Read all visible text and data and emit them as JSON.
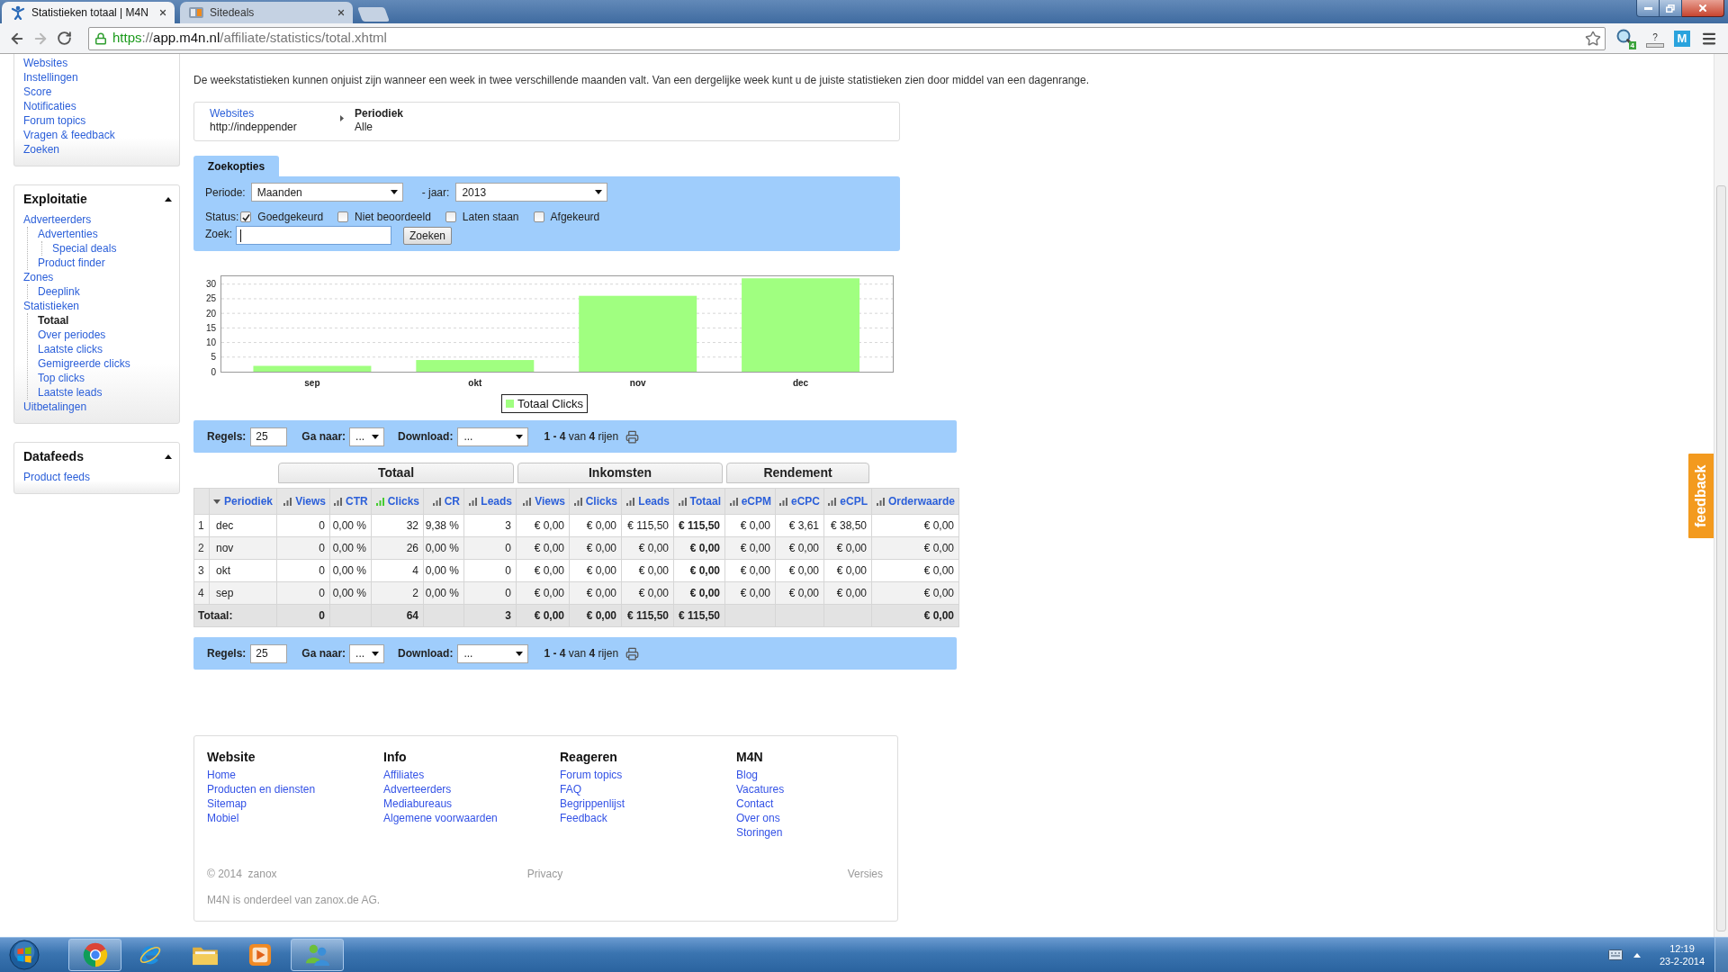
{
  "browser": {
    "tabs": [
      {
        "title": "Statistieken totaal | M4N",
        "selected": true,
        "kind": "figure"
      },
      {
        "title": "Sitedeals",
        "selected": false,
        "kind": "tile"
      }
    ],
    "nav_buttons": [
      {
        "kind": "back",
        "disabled": false
      },
      {
        "kind": "forward",
        "disabled": true
      },
      {
        "kind": "reload",
        "disabled": false
      }
    ],
    "address": [
      {
        "text": "https",
        "kind": "secure"
      },
      {
        "text": "://",
        "kind": "dim"
      },
      {
        "text": "app.m4n.nl",
        "kind": "host"
      },
      {
        "text": "/affiliate/statistics/total.xhtml",
        "kind": "dim"
      }
    ],
    "extensions": [
      {
        "kind": "magnifier",
        "badge": "4"
      },
      {
        "kind": "help",
        "label": "?"
      },
      {
        "kind": "logo",
        "label": "M"
      }
    ]
  },
  "sidebar": {
    "account_links": [
      "Websites",
      "Instellingen",
      "Score",
      "Notificaties",
      "Forum topics",
      "Vragen & feedback",
      "Zoeken"
    ],
    "panels": [
      {
        "title": "Exploitatie",
        "expanded": true,
        "items": [
          {
            "label": "Adverteerders",
            "selected": false,
            "children": [
              {
                "label": "Advertenties",
                "selected": false,
                "children": [
                  {
                    "label": "Special deals",
                    "selected": false
                  }
                ]
              },
              {
                "label": "Product finder",
                "selected": false
              }
            ]
          },
          {
            "label": "Zones",
            "selected": false,
            "children": [
              {
                "label": "Deeplink",
                "selected": false
              }
            ]
          },
          {
            "label": "Statistieken",
            "selected": false,
            "children": [
              {
                "label": "Totaal",
                "selected": true
              },
              {
                "label": "Over periodes",
                "selected": false
              },
              {
                "label": "Laatste clicks",
                "selected": false
              },
              {
                "label": "Gemigreerde clicks",
                "selected": false
              },
              {
                "label": "Top clicks",
                "selected": false
              },
              {
                "label": "Laatste leads",
                "selected": false
              }
            ]
          },
          {
            "label": "Uitbetalingen",
            "selected": false
          }
        ]
      },
      {
        "title": "Datafeeds",
        "expanded": true,
        "items": [
          {
            "label": "Product feeds",
            "selected": false
          }
        ]
      }
    ]
  },
  "notice": "De weekstatistieken kunnen onjuist zijn wanneer een week in twee verschillende maanden valt. Van een dergelijke week kunt u de juiste statistieken zien door middel van een dagenrange.",
  "breadcrumb": [
    {
      "label": "Websites",
      "value": "http://indeppender",
      "link": true
    },
    {
      "label": "Periodiek",
      "value": "Alle",
      "link": false
    }
  ],
  "search": {
    "tab": "Zoekopties",
    "period_label": "Periode:",
    "period": "Maanden",
    "year_label": "- jaar:",
    "year": "2013",
    "status_label": "Status:",
    "statuses": [
      {
        "label": "Goedgekeurd",
        "checked": true
      },
      {
        "label": "Niet beoordeeld",
        "checked": false
      },
      {
        "label": "Laten staan",
        "checked": false
      },
      {
        "label": "Afgekeurd",
        "checked": false
      }
    ],
    "query_label": "Zoek:",
    "query_focused": true,
    "button": "Zoeken"
  },
  "chart": {
    "chart_data": {
      "type": "bar",
      "categories": [
        "sep",
        "okt",
        "nov",
        "dec"
      ],
      "series": [
        {
          "name": "Totaal Clicks",
          "color": "#a0ff80",
          "values": [
            2,
            4,
            26,
            32
          ]
        }
      ],
      "ylim": [
        0,
        33
      ],
      "yticks": [
        0,
        5,
        10,
        15,
        20,
        25,
        30
      ],
      "grid": true
    }
  },
  "toolbars": [
    {
      "rows_label": "Regels:",
      "rows": "25",
      "goto_label": "Ga naar:",
      "goto": "...",
      "download_label": "Download:",
      "download": "...",
      "range": "**1 - 4** van **4** rijen"
    },
    {
      "rows_label": "Regels:",
      "rows": "25",
      "goto_label": "Ga naar:",
      "goto": "...",
      "download_label": "Download:",
      "download": "...",
      "range": "**1 - 4** van **4** rijen"
    }
  ],
  "table": {
    "header_groups": [
      {
        "columns": [
          {
            "label": "Periodiek",
            "kind": "period",
            "sorted": true,
            "charted": false,
            "emphasis": false
          }
        ]
      },
      {
        "label": "Totaal",
        "columns": [
          {
            "label": "Views",
            "kind": "metric",
            "sorted": false,
            "charted": false,
            "emphasis": false
          },
          {
            "label": "CTR",
            "kind": "metric",
            "sorted": false,
            "charted": false,
            "emphasis": false
          },
          {
            "label": "Clicks",
            "kind": "metric",
            "sorted": false,
            "charted": true,
            "emphasis": false
          },
          {
            "label": "CR",
            "kind": "metric",
            "sorted": false,
            "charted": false,
            "emphasis": false
          },
          {
            "label": "Leads",
            "kind": "metric",
            "sorted": false,
            "charted": false,
            "emphasis": false
          }
        ]
      },
      {
        "label": "Inkomsten",
        "columns": [
          {
            "label": "Views",
            "kind": "metric",
            "sorted": false,
            "charted": false,
            "emphasis": false
          },
          {
            "label": "Clicks",
            "kind": "metric",
            "sorted": false,
            "charted": false,
            "emphasis": false
          },
          {
            "label": "Leads",
            "kind": "metric",
            "sorted": false,
            "charted": false,
            "emphasis": false
          },
          {
            "label": "Totaal",
            "kind": "metric",
            "sorted": false,
            "charted": false,
            "emphasis": true
          }
        ]
      },
      {
        "label": "Rendement",
        "columns": [
          {
            "label": "eCPM",
            "kind": "metric",
            "sorted": false,
            "charted": false,
            "emphasis": false
          },
          {
            "label": "eCPC",
            "kind": "metric",
            "sorted": false,
            "charted": false,
            "emphasis": false
          },
          {
            "label": "eCPL",
            "kind": "metric",
            "sorted": false,
            "charted": false,
            "emphasis": false
          }
        ]
      },
      {
        "columns": [
          {
            "label": "Orderwaarde",
            "kind": "metric",
            "sorted": false,
            "charted": false,
            "emphasis": false
          }
        ]
      }
    ],
    "rows": [
      {
        "index": "1",
        "cells": [
          "dec",
          "0",
          "0,00 %",
          "32",
          "9,38 %",
          "3",
          "€ 0,00",
          "€ 0,00",
          "€ 115,50",
          "€ 115,50",
          "€ 0,00",
          "€ 3,61",
          "€ 38,50",
          "€ 0,00"
        ]
      },
      {
        "index": "2",
        "cells": [
          "nov",
          "0",
          "0,00 %",
          "26",
          "0,00 %",
          "0",
          "€ 0,00",
          "€ 0,00",
          "€ 0,00",
          "€ 0,00",
          "€ 0,00",
          "€ 0,00",
          "€ 0,00",
          "€ 0,00"
        ]
      },
      {
        "index": "3",
        "cells": [
          "okt",
          "0",
          "0,00 %",
          "4",
          "0,00 %",
          "0",
          "€ 0,00",
          "€ 0,00",
          "€ 0,00",
          "€ 0,00",
          "€ 0,00",
          "€ 0,00",
          "€ 0,00",
          "€ 0,00"
        ]
      },
      {
        "index": "4",
        "cells": [
          "sep",
          "0",
          "0,00 %",
          "2",
          "0,00 %",
          "0",
          "€ 0,00",
          "€ 0,00",
          "€ 0,00",
          "€ 0,00",
          "€ 0,00",
          "€ 0,00",
          "€ 0,00",
          "€ 0,00"
        ]
      }
    ],
    "total": {
      "label": "Totaal:",
      "cells": [
        "0",
        null,
        "64",
        null,
        "3",
        "€ 0,00",
        "€ 0,00",
        "€ 115,50",
        "€ 115,50",
        null,
        null,
        null,
        "€ 0,00"
      ]
    }
  },
  "footer": {
    "columns": [
      {
        "heading": "Website",
        "links": [
          "Home",
          "Producten en diensten",
          "Sitemap",
          "Mobiel"
        ]
      },
      {
        "heading": "Info",
        "links": [
          "Affiliates",
          "Adverteerders",
          "Mediabureaus",
          "Algemene voorwaarden"
        ]
      },
      {
        "heading": "Reageren",
        "links": [
          "Forum topics",
          "FAQ",
          "Begrippenlijst",
          "Feedback"
        ]
      },
      {
        "heading": "M4N",
        "links": [
          "Blog",
          "Vacatures",
          "Contact",
          "Over ons",
          "Storingen"
        ]
      }
    ],
    "copyright": "© 2014  zanox",
    "privacy": "Privacy",
    "versions": "Versies",
    "note": "M4N is onderdeel van zanox.de AG."
  },
  "feedback_tab": "feedback",
  "taskbar": {
    "apps": [
      {
        "kind": "chrome",
        "open": true
      },
      {
        "kind": "ie",
        "open": false
      },
      {
        "kind": "folder",
        "open": false
      },
      {
        "kind": "media",
        "open": false
      },
      {
        "kind": "messenger",
        "open": true
      }
    ],
    "time": "12:19",
    "date": "23-2-2014"
  }
}
